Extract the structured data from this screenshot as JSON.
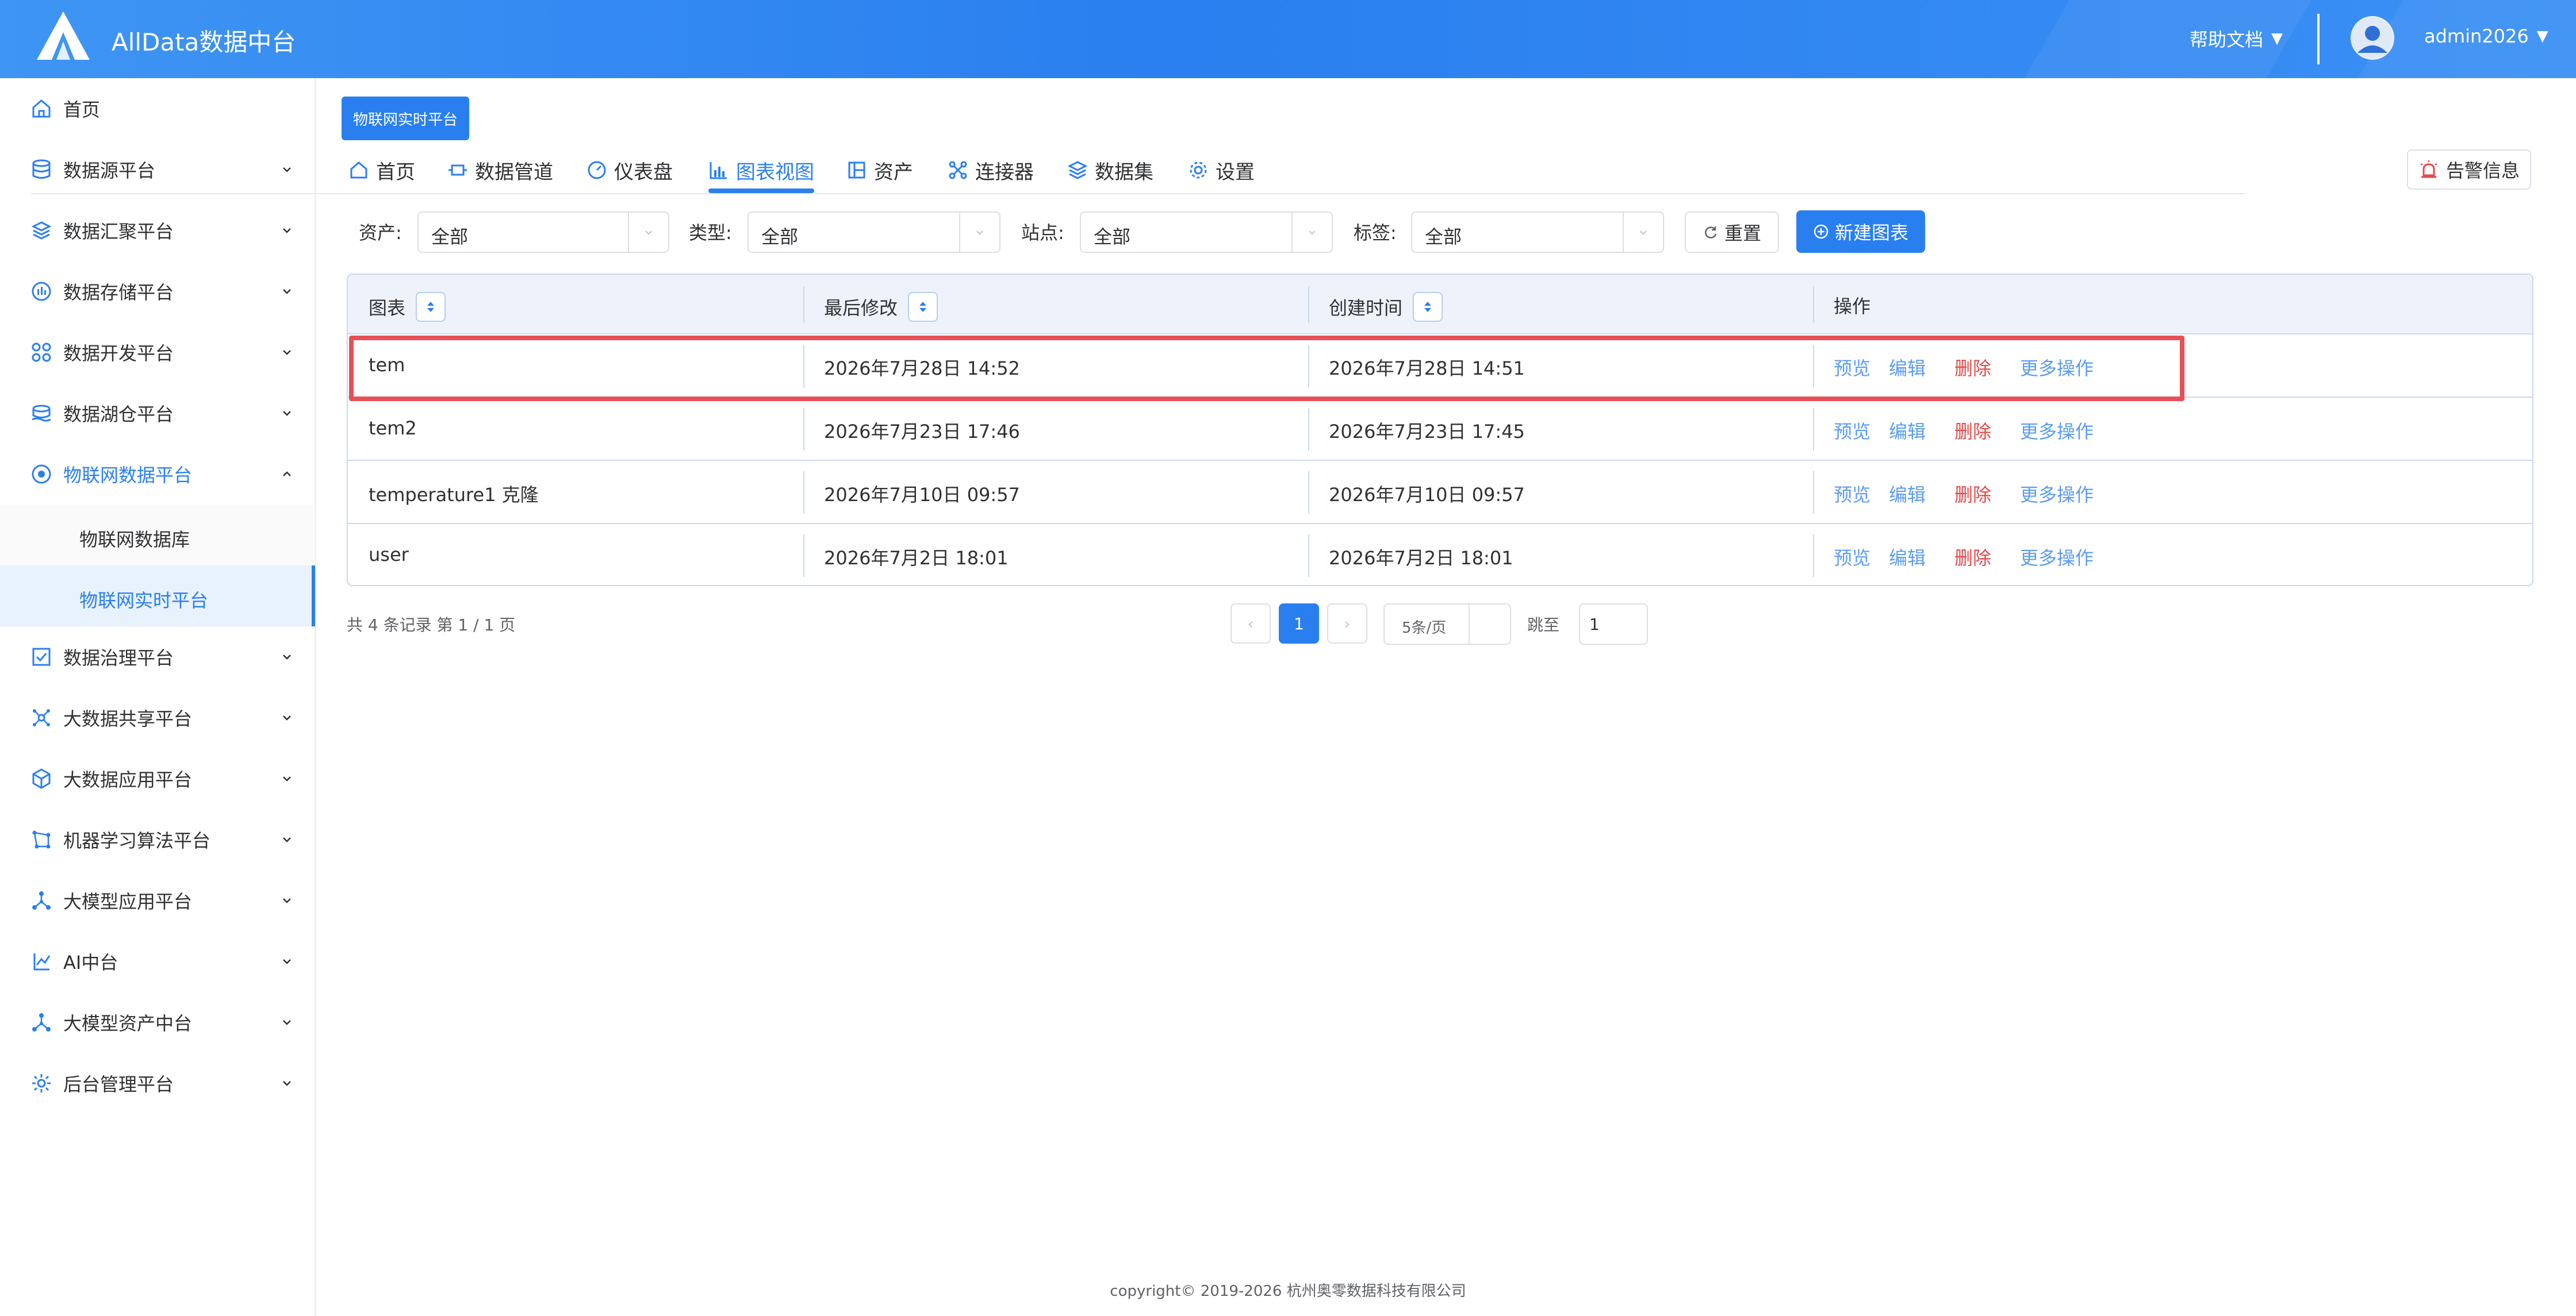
{
  "header": {
    "app_title": "AllData数据中台",
    "help_label": "帮助文档",
    "username": "admin2026",
    "caret": "▼"
  },
  "sidebar": {
    "items": [
      {
        "label": "首页"
      },
      {
        "label": "数据源平台"
      },
      {
        "label": "数据汇聚平台"
      },
      {
        "label": "数据存储平台"
      },
      {
        "label": "数据开发平台"
      },
      {
        "label": "数据湖仓平台"
      },
      {
        "label": "物联网数据平台"
      },
      {
        "label": "物联网数据库"
      },
      {
        "label": "物联网实时平台"
      },
      {
        "label": "数据治理平台"
      },
      {
        "label": "大数据共享平台"
      },
      {
        "label": "大数据应用平台"
      },
      {
        "label": "机器学习算法平台"
      },
      {
        "label": "大模型应用平台"
      },
      {
        "label": "AI中台"
      },
      {
        "label": "大模型资产中台"
      },
      {
        "label": "后台管理平台"
      }
    ]
  },
  "page": {
    "platform_tag": "物联网实时平台",
    "alarm_label": "告警信息",
    "tabs": [
      {
        "label": "首页"
      },
      {
        "label": "数据管道"
      },
      {
        "label": "仪表盘"
      },
      {
        "label": "图表视图"
      },
      {
        "label": "资产"
      },
      {
        "label": "连接器"
      },
      {
        "label": "数据集"
      },
      {
        "label": "设置"
      }
    ]
  },
  "filters": {
    "asset_label": "资产:",
    "asset_value": "全部",
    "type_label": "类型:",
    "type_value": "全部",
    "site_label": "站点:",
    "site_value": "全部",
    "tag_label": "标签:",
    "tag_value": "全部",
    "reset_label": "重置",
    "new_chart_label": "新建图表"
  },
  "table": {
    "headers": [
      "图表",
      "最后修改",
      "创建时间",
      "操作"
    ],
    "actions": {
      "preview": "预览",
      "edit": "编辑",
      "delete": "删除",
      "more": "更多操作"
    },
    "rows": [
      {
        "name": "tem",
        "modified": "2026年7月28日 14:52",
        "created": "2026年7月28日 14:51"
      },
      {
        "name": "tem2",
        "modified": "2026年7月23日 17:46",
        "created": "2026年7月23日 17:45"
      },
      {
        "name": "temperature1 克隆",
        "modified": "2026年7月10日 09:57",
        "created": "2026年7月10日 09:57"
      },
      {
        "name": "user",
        "modified": "2026年7月2日 18:01",
        "created": "2026年7月2日 18:01"
      }
    ]
  },
  "pagination": {
    "total_text": "共 4 条记录 第 1 / 1 页",
    "prev": "‹",
    "current_page": "1",
    "next": "›",
    "page_size": "5条/页",
    "jump_label": "跳至",
    "jump_value": "1"
  },
  "footer": {
    "copyright": "copyright© 2019-2026 杭州奥零数据科技有限公司"
  },
  "colors": {
    "primary": "#2a7ff0",
    "danger": "#e34b4b",
    "highlight": "#e94f56"
  }
}
